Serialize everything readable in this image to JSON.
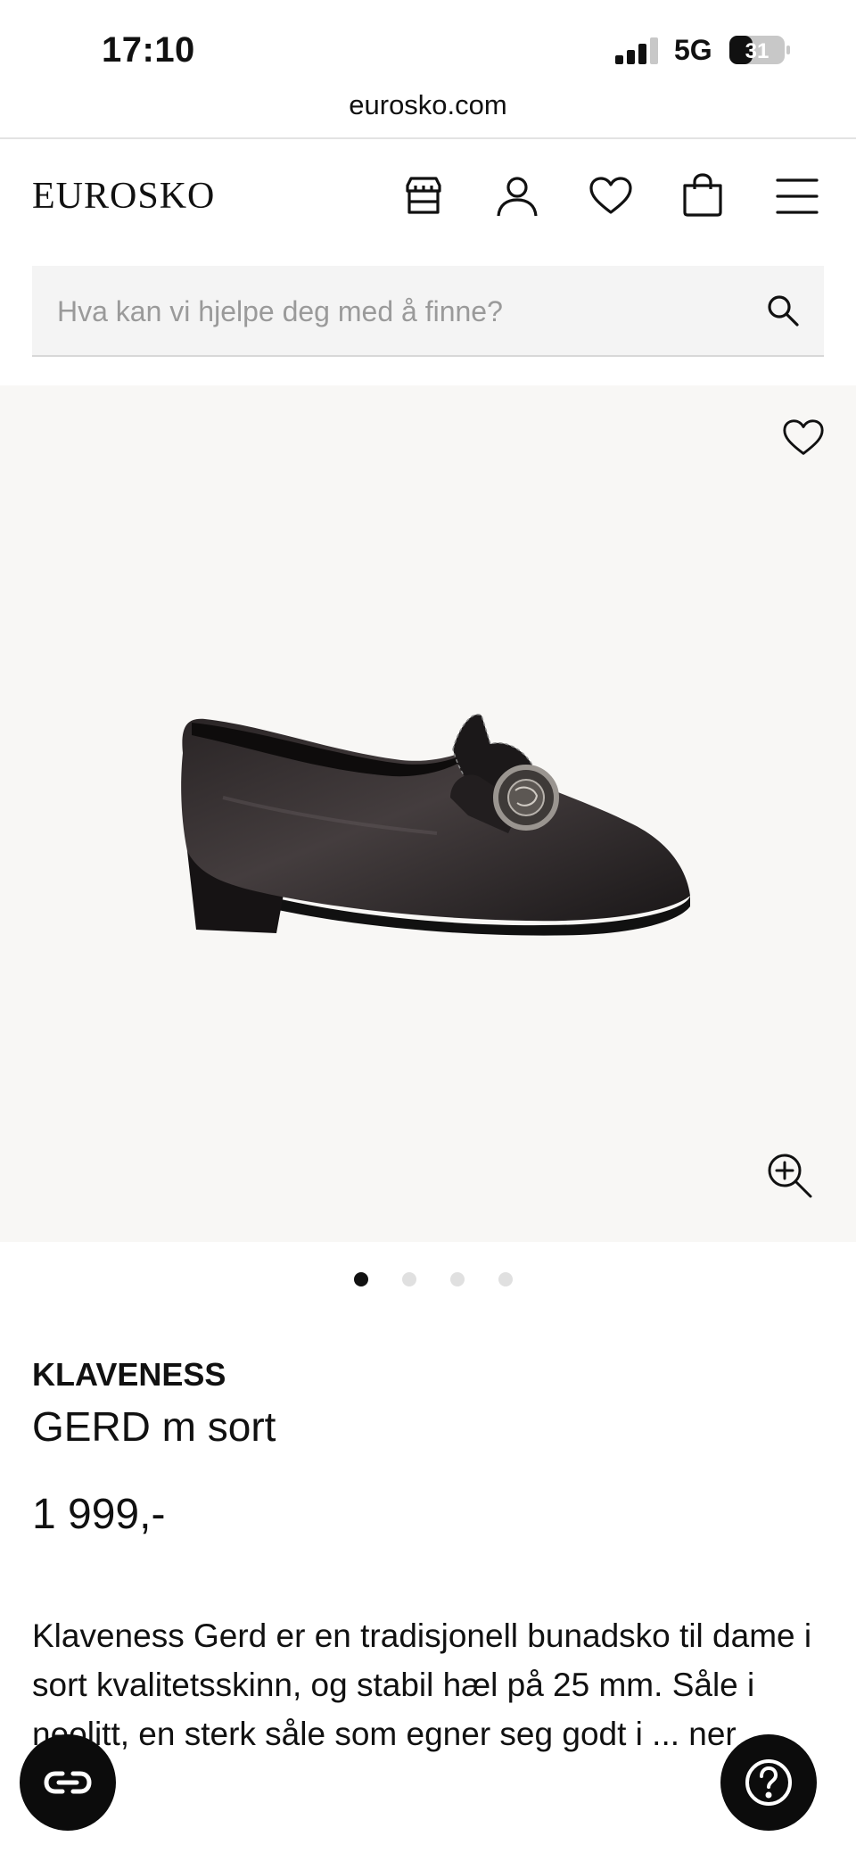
{
  "status_bar": {
    "time": "17:10",
    "network": "5G",
    "battery": "31"
  },
  "browser": {
    "url": "eurosko.com"
  },
  "header": {
    "logo": "EUROSKO",
    "icons": [
      "store-icon",
      "account-icon",
      "heart-icon",
      "bag-icon",
      "menu-icon"
    ]
  },
  "search": {
    "placeholder": "Hva kan vi hjelpe deg med å finne?",
    "value": ""
  },
  "gallery": {
    "image_count": 4,
    "active_index": 0,
    "background": "#f8f7f5"
  },
  "product": {
    "brand": "KLAVENESS",
    "name": "GERD m sort",
    "price": "1 999,-",
    "description": "Klaveness Gerd er en tradisjonell bunadsko til dame i sort kvalitetsskinn, og stabil hæl på 25 mm. Såle i neolitt, en sterk såle som egner seg godt i ... ner"
  },
  "colors": {
    "text": "#111111",
    "fab": "#0c0c0c",
    "search_bg": "#f4f4f4"
  }
}
